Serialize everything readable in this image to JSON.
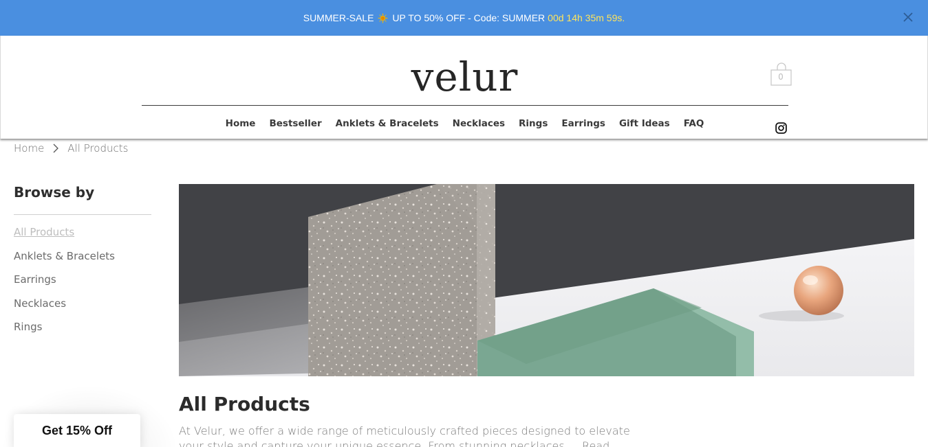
{
  "announcement": {
    "text_before": "SUMMER-SALE",
    "text_after": "UP TO 50% OFF - Code: SUMMER",
    "countdown": "00d 14h 35m 59s.",
    "sun_icon": "sun-icon",
    "close_icon": "close-icon",
    "background": "#4a8fe0",
    "countdown_color": "#ffe45c"
  },
  "header": {
    "logo": "velur",
    "cart": {
      "icon": "shopping-bag-icon",
      "count": "0"
    },
    "social_icon": "instagram-icon"
  },
  "nav": {
    "items": [
      {
        "label": "Home"
      },
      {
        "label": "Bestseller"
      },
      {
        "label": "Anklets & Bracelets"
      },
      {
        "label": "Necklaces"
      },
      {
        "label": "Rings"
      },
      {
        "label": "Earrings"
      },
      {
        "label": "Gift Ideas"
      },
      {
        "label": "FAQ"
      }
    ]
  },
  "breadcrumb": {
    "home": "Home",
    "separator_icon": "chevron-right-icon",
    "current": "All Products"
  },
  "sidebar": {
    "title": "Browse by",
    "items": [
      {
        "label": "All Products",
        "active": true
      },
      {
        "label": "Anklets & Bracelets"
      },
      {
        "label": "Earrings"
      },
      {
        "label": "Necklaces"
      },
      {
        "label": "Rings"
      }
    ]
  },
  "main": {
    "heading": "All Products",
    "description": "At Velur, we offer a wide range of meticulously crafted pieces designed to elevate your style and capture your unique essence. From stunning necklaces",
    "read_more": "Read more"
  },
  "promo": {
    "label": "Get 15% Off"
  }
}
